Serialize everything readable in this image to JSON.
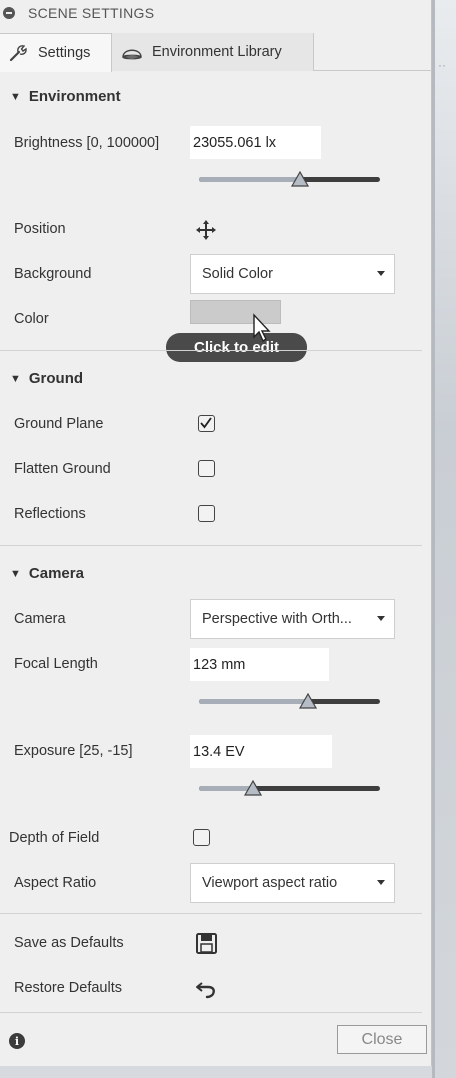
{
  "panel": {
    "title": "SCENE SETTINGS"
  },
  "tabs": [
    {
      "label": "Settings",
      "icon": "wrench-icon",
      "active": true
    },
    {
      "label": "Environment Library",
      "icon": "dome-icon",
      "active": false
    }
  ],
  "environment": {
    "header": "Environment",
    "brightness": {
      "label": "Brightness [0, 100000]",
      "value": "23055.061 lx",
      "slider_fraction": 0.55
    },
    "position": {
      "label": "Position",
      "icon": "move-icon"
    },
    "background": {
      "label": "Background",
      "value": "Solid Color"
    },
    "color": {
      "label": "Color",
      "swatch": "#cbcbcb",
      "tooltip": "Click to edit"
    }
  },
  "ground": {
    "header": "Ground",
    "ground_plane": {
      "label": "Ground Plane",
      "checked": true
    },
    "flatten_ground": {
      "label": "Flatten Ground",
      "checked": false
    },
    "reflections": {
      "label": "Reflections",
      "checked": false
    }
  },
  "camera": {
    "header": "Camera",
    "camera": {
      "label": "Camera",
      "value": "Perspective with Orth..."
    },
    "focal_length": {
      "label": "Focal Length",
      "value": "123 mm",
      "slider_fraction": 0.6
    },
    "exposure": {
      "label": "Exposure [25, -15]",
      "value": "13.4 EV",
      "slider_fraction": 0.3
    },
    "depth_of_field": {
      "label": "Depth of Field",
      "checked": false
    },
    "aspect_ratio": {
      "label": "Aspect Ratio",
      "value": "Viewport aspect ratio"
    }
  },
  "defaults": {
    "save_label": "Save as Defaults",
    "restore_label": "Restore Defaults"
  },
  "footer": {
    "close_label": "Close"
  },
  "colors": {
    "panel_bg": "#efefef",
    "slider_fill": "#a7aeb8",
    "slider_track": "#3e3e3e",
    "tooltip_bg": "#4a4a4a"
  }
}
